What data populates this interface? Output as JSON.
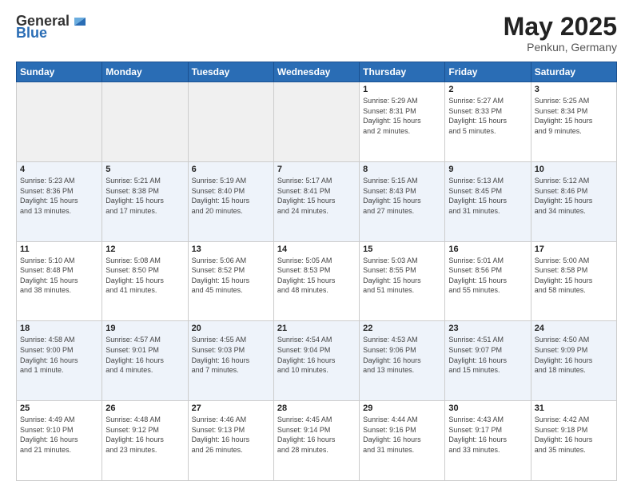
{
  "header": {
    "logo_general": "General",
    "logo_blue": "Blue",
    "month_year": "May 2025",
    "location": "Penkun, Germany"
  },
  "weekdays": [
    "Sunday",
    "Monday",
    "Tuesday",
    "Wednesday",
    "Thursday",
    "Friday",
    "Saturday"
  ],
  "weeks": [
    [
      {
        "day": "",
        "info": ""
      },
      {
        "day": "",
        "info": ""
      },
      {
        "day": "",
        "info": ""
      },
      {
        "day": "",
        "info": ""
      },
      {
        "day": "1",
        "info": "Sunrise: 5:29 AM\nSunset: 8:31 PM\nDaylight: 15 hours\nand 2 minutes."
      },
      {
        "day": "2",
        "info": "Sunrise: 5:27 AM\nSunset: 8:33 PM\nDaylight: 15 hours\nand 5 minutes."
      },
      {
        "day": "3",
        "info": "Sunrise: 5:25 AM\nSunset: 8:34 PM\nDaylight: 15 hours\nand 9 minutes."
      }
    ],
    [
      {
        "day": "4",
        "info": "Sunrise: 5:23 AM\nSunset: 8:36 PM\nDaylight: 15 hours\nand 13 minutes."
      },
      {
        "day": "5",
        "info": "Sunrise: 5:21 AM\nSunset: 8:38 PM\nDaylight: 15 hours\nand 17 minutes."
      },
      {
        "day": "6",
        "info": "Sunrise: 5:19 AM\nSunset: 8:40 PM\nDaylight: 15 hours\nand 20 minutes."
      },
      {
        "day": "7",
        "info": "Sunrise: 5:17 AM\nSunset: 8:41 PM\nDaylight: 15 hours\nand 24 minutes."
      },
      {
        "day": "8",
        "info": "Sunrise: 5:15 AM\nSunset: 8:43 PM\nDaylight: 15 hours\nand 27 minutes."
      },
      {
        "day": "9",
        "info": "Sunrise: 5:13 AM\nSunset: 8:45 PM\nDaylight: 15 hours\nand 31 minutes."
      },
      {
        "day": "10",
        "info": "Sunrise: 5:12 AM\nSunset: 8:46 PM\nDaylight: 15 hours\nand 34 minutes."
      }
    ],
    [
      {
        "day": "11",
        "info": "Sunrise: 5:10 AM\nSunset: 8:48 PM\nDaylight: 15 hours\nand 38 minutes."
      },
      {
        "day": "12",
        "info": "Sunrise: 5:08 AM\nSunset: 8:50 PM\nDaylight: 15 hours\nand 41 minutes."
      },
      {
        "day": "13",
        "info": "Sunrise: 5:06 AM\nSunset: 8:52 PM\nDaylight: 15 hours\nand 45 minutes."
      },
      {
        "day": "14",
        "info": "Sunrise: 5:05 AM\nSunset: 8:53 PM\nDaylight: 15 hours\nand 48 minutes."
      },
      {
        "day": "15",
        "info": "Sunrise: 5:03 AM\nSunset: 8:55 PM\nDaylight: 15 hours\nand 51 minutes."
      },
      {
        "day": "16",
        "info": "Sunrise: 5:01 AM\nSunset: 8:56 PM\nDaylight: 15 hours\nand 55 minutes."
      },
      {
        "day": "17",
        "info": "Sunrise: 5:00 AM\nSunset: 8:58 PM\nDaylight: 15 hours\nand 58 minutes."
      }
    ],
    [
      {
        "day": "18",
        "info": "Sunrise: 4:58 AM\nSunset: 9:00 PM\nDaylight: 16 hours\nand 1 minute."
      },
      {
        "day": "19",
        "info": "Sunrise: 4:57 AM\nSunset: 9:01 PM\nDaylight: 16 hours\nand 4 minutes."
      },
      {
        "day": "20",
        "info": "Sunrise: 4:55 AM\nSunset: 9:03 PM\nDaylight: 16 hours\nand 7 minutes."
      },
      {
        "day": "21",
        "info": "Sunrise: 4:54 AM\nSunset: 9:04 PM\nDaylight: 16 hours\nand 10 minutes."
      },
      {
        "day": "22",
        "info": "Sunrise: 4:53 AM\nSunset: 9:06 PM\nDaylight: 16 hours\nand 13 minutes."
      },
      {
        "day": "23",
        "info": "Sunrise: 4:51 AM\nSunset: 9:07 PM\nDaylight: 16 hours\nand 15 minutes."
      },
      {
        "day": "24",
        "info": "Sunrise: 4:50 AM\nSunset: 9:09 PM\nDaylight: 16 hours\nand 18 minutes."
      }
    ],
    [
      {
        "day": "25",
        "info": "Sunrise: 4:49 AM\nSunset: 9:10 PM\nDaylight: 16 hours\nand 21 minutes."
      },
      {
        "day": "26",
        "info": "Sunrise: 4:48 AM\nSunset: 9:12 PM\nDaylight: 16 hours\nand 23 minutes."
      },
      {
        "day": "27",
        "info": "Sunrise: 4:46 AM\nSunset: 9:13 PM\nDaylight: 16 hours\nand 26 minutes."
      },
      {
        "day": "28",
        "info": "Sunrise: 4:45 AM\nSunset: 9:14 PM\nDaylight: 16 hours\nand 28 minutes."
      },
      {
        "day": "29",
        "info": "Sunrise: 4:44 AM\nSunset: 9:16 PM\nDaylight: 16 hours\nand 31 minutes."
      },
      {
        "day": "30",
        "info": "Sunrise: 4:43 AM\nSunset: 9:17 PM\nDaylight: 16 hours\nand 33 minutes."
      },
      {
        "day": "31",
        "info": "Sunrise: 4:42 AM\nSunset: 9:18 PM\nDaylight: 16 hours\nand 35 minutes."
      }
    ]
  ]
}
